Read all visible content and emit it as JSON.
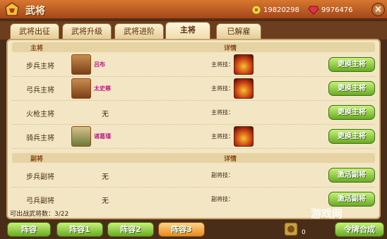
{
  "window": {
    "title": "武将",
    "close": "×"
  },
  "resources": {
    "gold": "19820298",
    "gems": "9976476"
  },
  "tabs": [
    "武将出征",
    "武将升级",
    "武将进阶",
    "主将",
    "已解雇"
  ],
  "main_section": {
    "col1": "主将",
    "col2": "详情"
  },
  "main_rows": [
    {
      "label": "步兵主将",
      "general": "吕布",
      "skill_label": "主将技：",
      "button": "更换主将"
    },
    {
      "label": "弓兵主将",
      "general": "太史慈",
      "skill_label": "主将技：",
      "button": "更换主将"
    },
    {
      "label": "火枪主将",
      "general": "无",
      "skill_label": "主将技：",
      "button": "更换主将"
    },
    {
      "label": "骑兵主将",
      "general": "诸葛瑾",
      "skill_label": "主将技：",
      "button": "更换主将"
    }
  ],
  "sub_section": {
    "col1": "副将",
    "col2": "详情"
  },
  "sub_rows": [
    {
      "label": "步兵副将",
      "general": "无",
      "skill_label": "副将技：",
      "button": "激活副将"
    },
    {
      "label": "弓兵副将",
      "general": "无",
      "skill_label": "副将技：",
      "button": "激活副将"
    }
  ],
  "count_text": "可出战武将数：3/22",
  "bottom_tabs": [
    "阵容",
    "阵容1",
    "阵容2",
    "阵容3"
  ],
  "token_count": "0",
  "synth_button": "令牌合成",
  "watermark": "游戏网",
  "colors": {
    "accent": "#d7772f",
    "button": "#6aaa22",
    "active_tab": "#e8891e",
    "name": "#c01a84"
  },
  "icons": [
    "helmet-logo-icon",
    "coin-icon",
    "gem-icon",
    "close-icon",
    "token-icon"
  ]
}
